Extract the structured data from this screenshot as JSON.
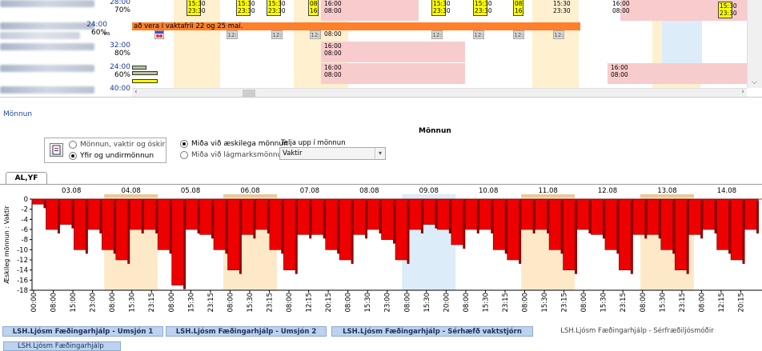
{
  "schedule": {
    "employees": [
      {
        "hours": "28:00",
        "pct": "70%",
        "va": ""
      },
      {
        "hours": "24:00",
        "pct": "60%",
        "va": "va"
      },
      {
        "hours": "32:00",
        "pct": "80%",
        "va": ""
      },
      {
        "hours": "24:00",
        "pct": "60%",
        "va": ""
      },
      {
        "hours": "40:00",
        "pct": "",
        "va": ""
      }
    ],
    "shift_start": "15:30",
    "shift_end": "23:30",
    "short_shift_start": "08",
    "short_shift_end": "16",
    "pink_start": "16:00",
    "pink_end": "08:00",
    "grey_tag": "12:",
    "grey_tag_time": "08:00",
    "orange_note": "að vera í vaktafríi 22 og 25 maí.",
    "colors": {
      "shift": "#ffff00",
      "pink": "#f8cccc",
      "orange": "#ff7f2a",
      "weekend": "#fff0d0",
      "holiday": "#dcecf8"
    }
  },
  "monnun": {
    "link_label": "Mönnun",
    "title": "Mönnun",
    "icon": "report-icon",
    "radio_group1": [
      {
        "label": "Mönnun, vaktir og óskir",
        "checked": false
      },
      {
        "label": "Yfir og undirmönnun",
        "checked": true
      }
    ],
    "radio_group2": [
      {
        "label": "Miða við æskilega mönnun",
        "checked": true
      },
      {
        "label": "Miða við lágmarksmönnun",
        "checked": false
      }
    ],
    "telja_label": "Telja upp í mönnun",
    "telja_value": "Vaktir"
  },
  "chart_tab": "AL,YF",
  "chart_data": {
    "type": "bar",
    "ylabel": "Æskileg mönnun : Vaktir",
    "ylim": [
      -18,
      0
    ],
    "yticks": [
      0,
      -2,
      -4,
      -6,
      -8,
      -10,
      -12,
      -14,
      -16,
      -18
    ],
    "days": [
      "03.08",
      "04.08",
      "05.08",
      "06.08",
      "07.08",
      "08.08",
      "09.08",
      "10.08",
      "11.08",
      "12.08",
      "13.08",
      "14.08"
    ],
    "weekend_days": [
      1,
      3,
      8,
      10
    ],
    "holiday_days": [
      6
    ],
    "x_tick_labels": [
      "00:00",
      "08:00",
      "15:00",
      "23:00",
      "08:00",
      "15:30",
      "23:15",
      "08:00",
      "15:30",
      "23:15",
      "08:00",
      "15:30",
      "23:15",
      "08:00",
      "12:15",
      "20:15",
      "08:00",
      "15:30",
      "23:00",
      "08:00",
      "15:30",
      "20:00",
      "08:00",
      "15:30",
      "23:15",
      "08:00",
      "15:30",
      "23:15",
      "08:00",
      "15:30",
      "23:15",
      "08:00",
      "15:30",
      "23:15",
      "08:00",
      "12:15",
      "20:15"
    ],
    "values": [
      -1,
      -6,
      -5,
      -10,
      -6,
      -10,
      -12,
      -6,
      -6,
      -10,
      -17,
      -6,
      -7,
      -10,
      -14,
      -7,
      -6,
      -10,
      -14,
      -7,
      -7,
      -10,
      -12,
      -7,
      -6,
      -8,
      -12,
      -6,
      -5,
      -6,
      -9,
      -6,
      -6,
      -10,
      -12,
      -6,
      -6,
      -10,
      -14,
      -6,
      -7,
      -10,
      -14,
      -7,
      -7,
      -10,
      -14,
      -7,
      -6,
      -10,
      -12,
      -6
    ]
  },
  "bottom_tabs": [
    {
      "label": "LSH.Ljósm Fæðingarhjálp - Umsjón 1",
      "active": true
    },
    {
      "label": "LSH.Ljósm Fæðingarhjálp - Umsjón 2",
      "active": true
    },
    {
      "label": "LSH.Ljósm Fæðingarhjálp - Sérhæfð vaktstjórn",
      "active": true
    },
    {
      "label": "LSH.Ljósm Fæðingarhjálp - Sérfræðiljósmóðir",
      "active": false
    }
  ],
  "bottom_tab2": "LSH.Ljósm Fæðingarhjálp"
}
